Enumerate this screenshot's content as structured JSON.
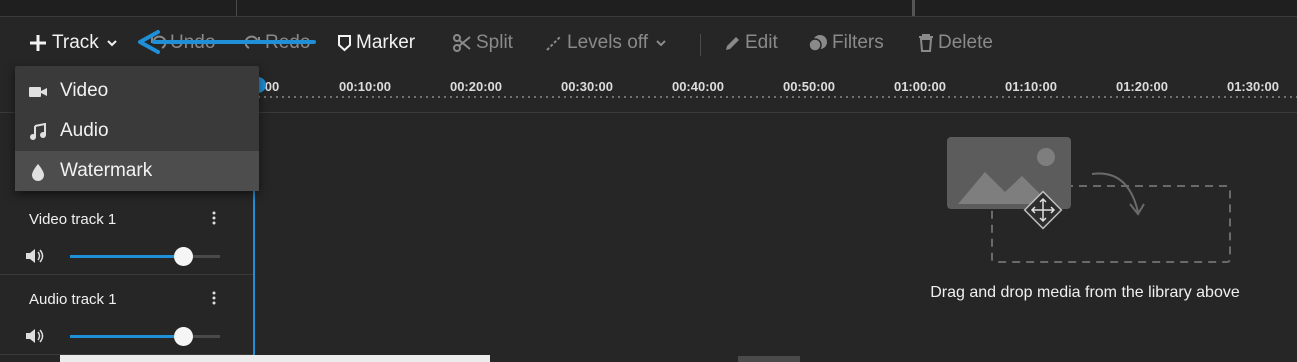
{
  "toolbar": {
    "add_track_label": "Track",
    "undo_label": "Undo",
    "redo_label": "Redo",
    "marker_label": "Marker",
    "split_label": "Split",
    "levels_label": "Levels off",
    "edit_label": "Edit",
    "filters_label": "Filters",
    "delete_label": "Delete"
  },
  "track_menu": {
    "items": [
      {
        "label": "Video",
        "icon": "video-camera-icon"
      },
      {
        "label": "Audio",
        "icon": "music-note-icon"
      },
      {
        "label": "Watermark",
        "icon": "droplet-icon"
      }
    ],
    "hovered_index": 2
  },
  "ruler": {
    "first_partial": "00",
    "ticks": [
      "00:10:00",
      "00:20:00",
      "00:30:00",
      "00:40:00",
      "00:50:00",
      "01:00:00",
      "01:10:00",
      "01:20:00",
      "01:30:00"
    ]
  },
  "tracks": [
    {
      "name": "Video track 1",
      "volume": 0.75
    },
    {
      "name": "Audio track 1",
      "volume": 0.75
    }
  ],
  "dropzone": {
    "caption": "Drag and drop media from the library above"
  },
  "colors": {
    "accent": "#1f8fd8",
    "background": "#262626",
    "menu_background": "#3a3a3a",
    "menu_hover": "#4d4d4d"
  }
}
